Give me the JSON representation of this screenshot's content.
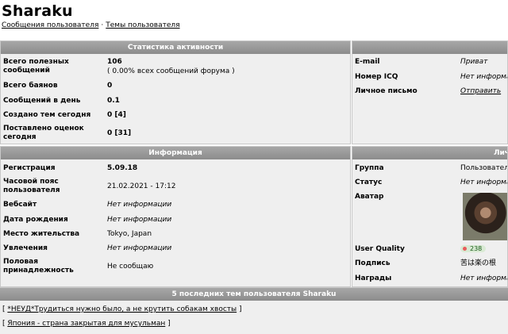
{
  "page": {
    "title": "Sharaku",
    "breadcrumbs": [
      "Сообщения пользователя",
      "Темы пользователя"
    ],
    "separator": "·"
  },
  "activity": {
    "header": "Статистика активности",
    "rows": [
      {
        "label": "Всего полезных сообщений",
        "value": "106",
        "sub": "( 0.00% всех сообщений форума )"
      },
      {
        "label": "Всего баянов",
        "value": "0"
      },
      {
        "label": "Сообщений в день",
        "value": "0.1"
      },
      {
        "label": "Создано тем сегодня",
        "value": "0 [4]"
      },
      {
        "label": "Поставлено оценок сегодня",
        "value": "0 [31]"
      }
    ]
  },
  "contacts": {
    "rows": [
      {
        "label": "E-mail",
        "value": "Приват"
      },
      {
        "label": "Номер ICQ",
        "value": "Нет информации"
      },
      {
        "label": "Личное письмо",
        "value": "Отправить"
      }
    ]
  },
  "info": {
    "header": "Информация",
    "rows": [
      {
        "label": "Регистрация",
        "value": "5.09.18"
      },
      {
        "label": "Часовой пояс пользователя",
        "value": "21.02.2021 - 17:12"
      },
      {
        "label": "Вебсайт",
        "value": "Нет информации"
      },
      {
        "label": "Дата рождения",
        "value": "Нет информации"
      },
      {
        "label": "Место жительства",
        "value": "Tokyo, Japan"
      },
      {
        "label": "Увлечения",
        "value": "Нет информации"
      },
      {
        "label": "Половая принадлежность",
        "value": "Не сообщаю"
      }
    ]
  },
  "personal": {
    "header": "Личная информация",
    "rows": [
      {
        "label": "Группа",
        "value": "Пользователи"
      },
      {
        "label": "Статус",
        "value": "Нет информации"
      },
      {
        "label": "Аватар",
        "value": ""
      },
      {
        "label": "User Quality",
        "value": "238"
      },
      {
        "label": "Подпись",
        "value": "苦は楽の根"
      },
      {
        "label": "Награды",
        "value": "Нет информации"
      }
    ]
  },
  "topics": {
    "header": "5 последних тем пользователя Sharaku",
    "items": [
      "*НЕУД*Трудиться нужно было, а не крутить собакам хвосты",
      "Япония - страна закрытая для мусульман"
    ]
  }
}
